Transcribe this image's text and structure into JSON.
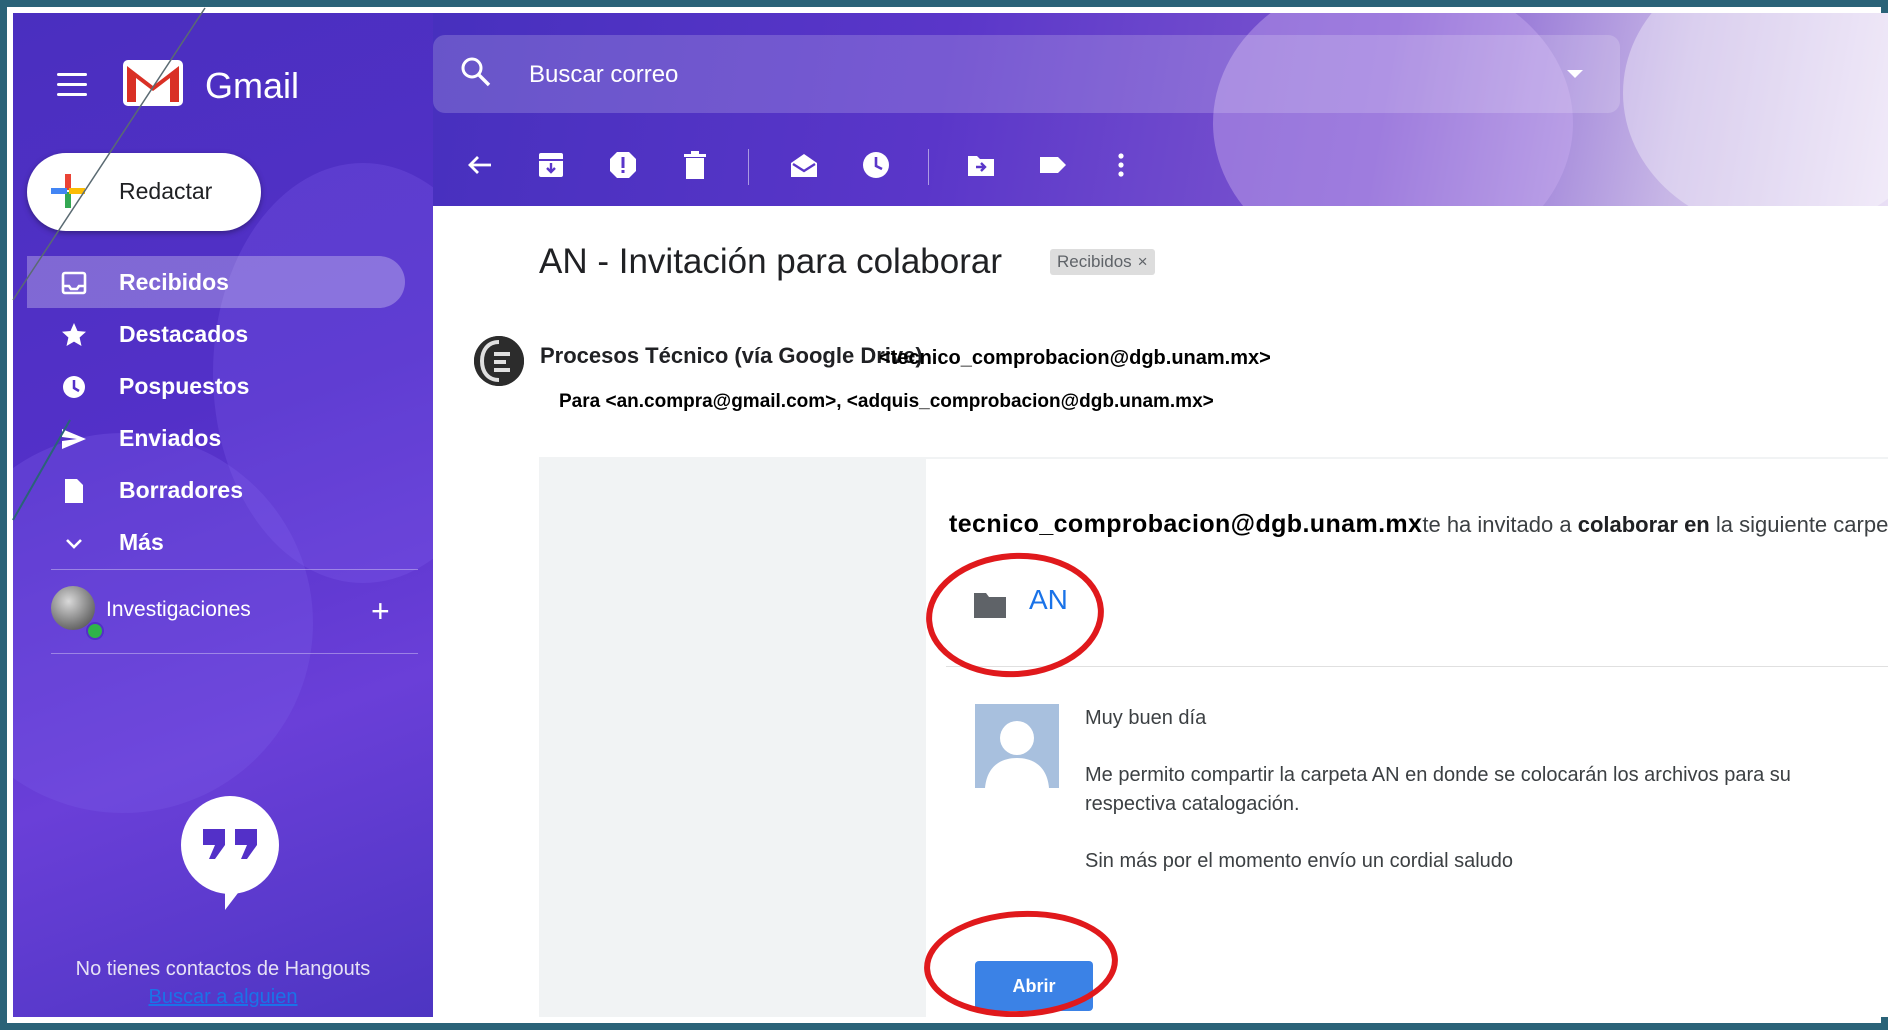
{
  "app": {
    "name": "Gmail",
    "search": {
      "placeholder": "Buscar correo"
    },
    "compose_label": "Redactar"
  },
  "sidebar": {
    "items": [
      {
        "label": "Recibidos",
        "icon": "inbox-icon",
        "active": true
      },
      {
        "label": "Destacados",
        "icon": "star-icon"
      },
      {
        "label": "Pospuestos",
        "icon": "clock-icon"
      },
      {
        "label": "Enviados",
        "icon": "send-icon"
      },
      {
        "label": "Borradores",
        "icon": "draft-icon"
      },
      {
        "label": "Más",
        "icon": "chevron-down-icon"
      }
    ],
    "hangouts_user": "Investigaciones",
    "hangouts_empty": "No tienes contactos de Hangouts",
    "hangouts_link": "Buscar a alguien"
  },
  "toolbar": {
    "icons": [
      "back-arrow-icon",
      "archive-icon",
      "report-spam-icon",
      "delete-icon",
      "mark-unread-icon",
      "snooze-icon",
      "move-to-icon",
      "label-icon",
      "more-options-icon"
    ]
  },
  "email": {
    "subject": "AN - Invitación para colaborar",
    "label_chip": "Recibidos",
    "label_chip_close": "×",
    "sender_name": "Procesos Técnico (vía Google Drive)",
    "sender_email": "<tecnico_comprobacion@dgb.unam.mx>",
    "to_line": "Para <an.compra@gmail.com>, <adquis_comprobacion@dgb.unam.mx>",
    "invite_email": "tecnico_comprobacion@dgb.unam.mx",
    "invite_text_1": "te ha invitado a ",
    "invite_text_bold": "colaborar en",
    "invite_text_2": " la siguiente carpeta",
    "folder_name": "AN",
    "message_greeting": "Muy buen día",
    "message_line_1": "Me permito compartir la carpeta AN en donde se colocarán los archivos para su",
    "message_line_2": "respectiva catalogación.",
    "message_closing": "Sin más por el momento envío un cordial saludo",
    "open_button": "Abrir"
  },
  "colors": {
    "sidebar_purple": "#5330c8",
    "frame_teal": "#2a6378",
    "annotation_red": "#e0191c",
    "button_blue": "#3b82e6",
    "link_blue": "#1a73e8"
  }
}
